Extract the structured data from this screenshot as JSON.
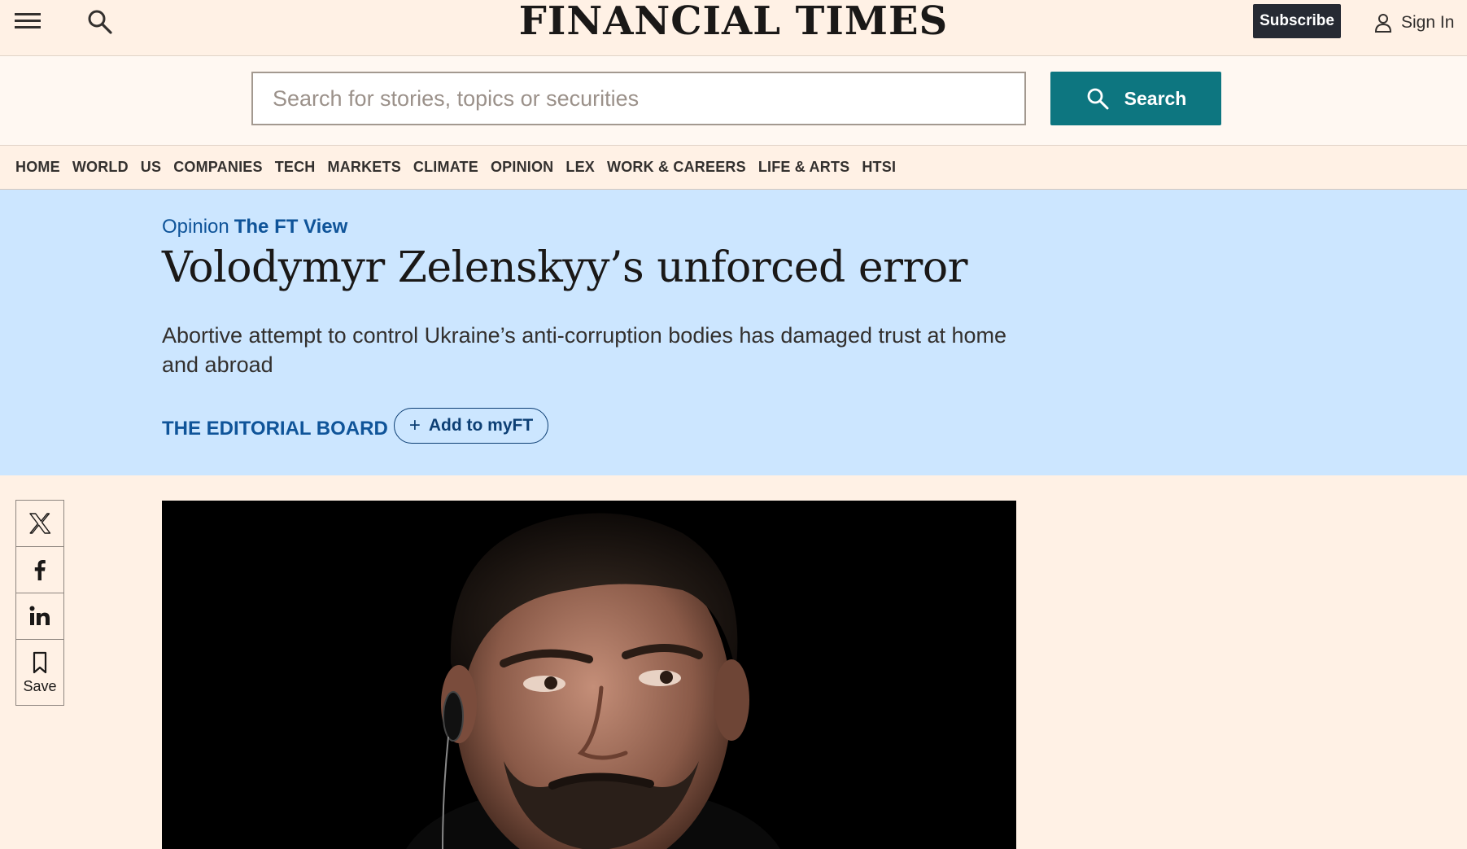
{
  "header": {
    "masthead": "FINANCIAL TIMES",
    "subscribe_label": "Subscribe",
    "signin_label": "Sign In"
  },
  "search": {
    "placeholder": "Search for stories, topics or securities",
    "value": "",
    "button_label": "Search"
  },
  "nav": {
    "items": [
      {
        "label": "HOME"
      },
      {
        "label": "WORLD"
      },
      {
        "label": "US"
      },
      {
        "label": "COMPANIES"
      },
      {
        "label": "TECH"
      },
      {
        "label": "MARKETS"
      },
      {
        "label": "CLIMATE"
      },
      {
        "label": "OPINION"
      },
      {
        "label": "LEX"
      },
      {
        "label": "WORK & CAREERS"
      },
      {
        "label": "LIFE & ARTS"
      },
      {
        "label": "HTSI"
      }
    ]
  },
  "article": {
    "kicker_section": "Opinion",
    "kicker_series": "The FT View",
    "headline": "Volodymyr Zelenskyy’s unforced error",
    "standfirst": "Abortive attempt to control Ukraine’s anti-corruption bodies has damaged trust at home and abroad",
    "author": "THE EDITORIAL BOARD",
    "myft_label": "Add to myFT"
  },
  "share": {
    "save_label": "Save",
    "icons": [
      "x-icon",
      "facebook-icon",
      "linkedin-icon",
      "bookmark-icon"
    ]
  },
  "colors": {
    "page_bg": "#fff1e5",
    "hero_bg": "#cce6ff",
    "teal": "#0d7680",
    "link_blue": "#0f5499",
    "subscribe_bg": "#262a33"
  }
}
